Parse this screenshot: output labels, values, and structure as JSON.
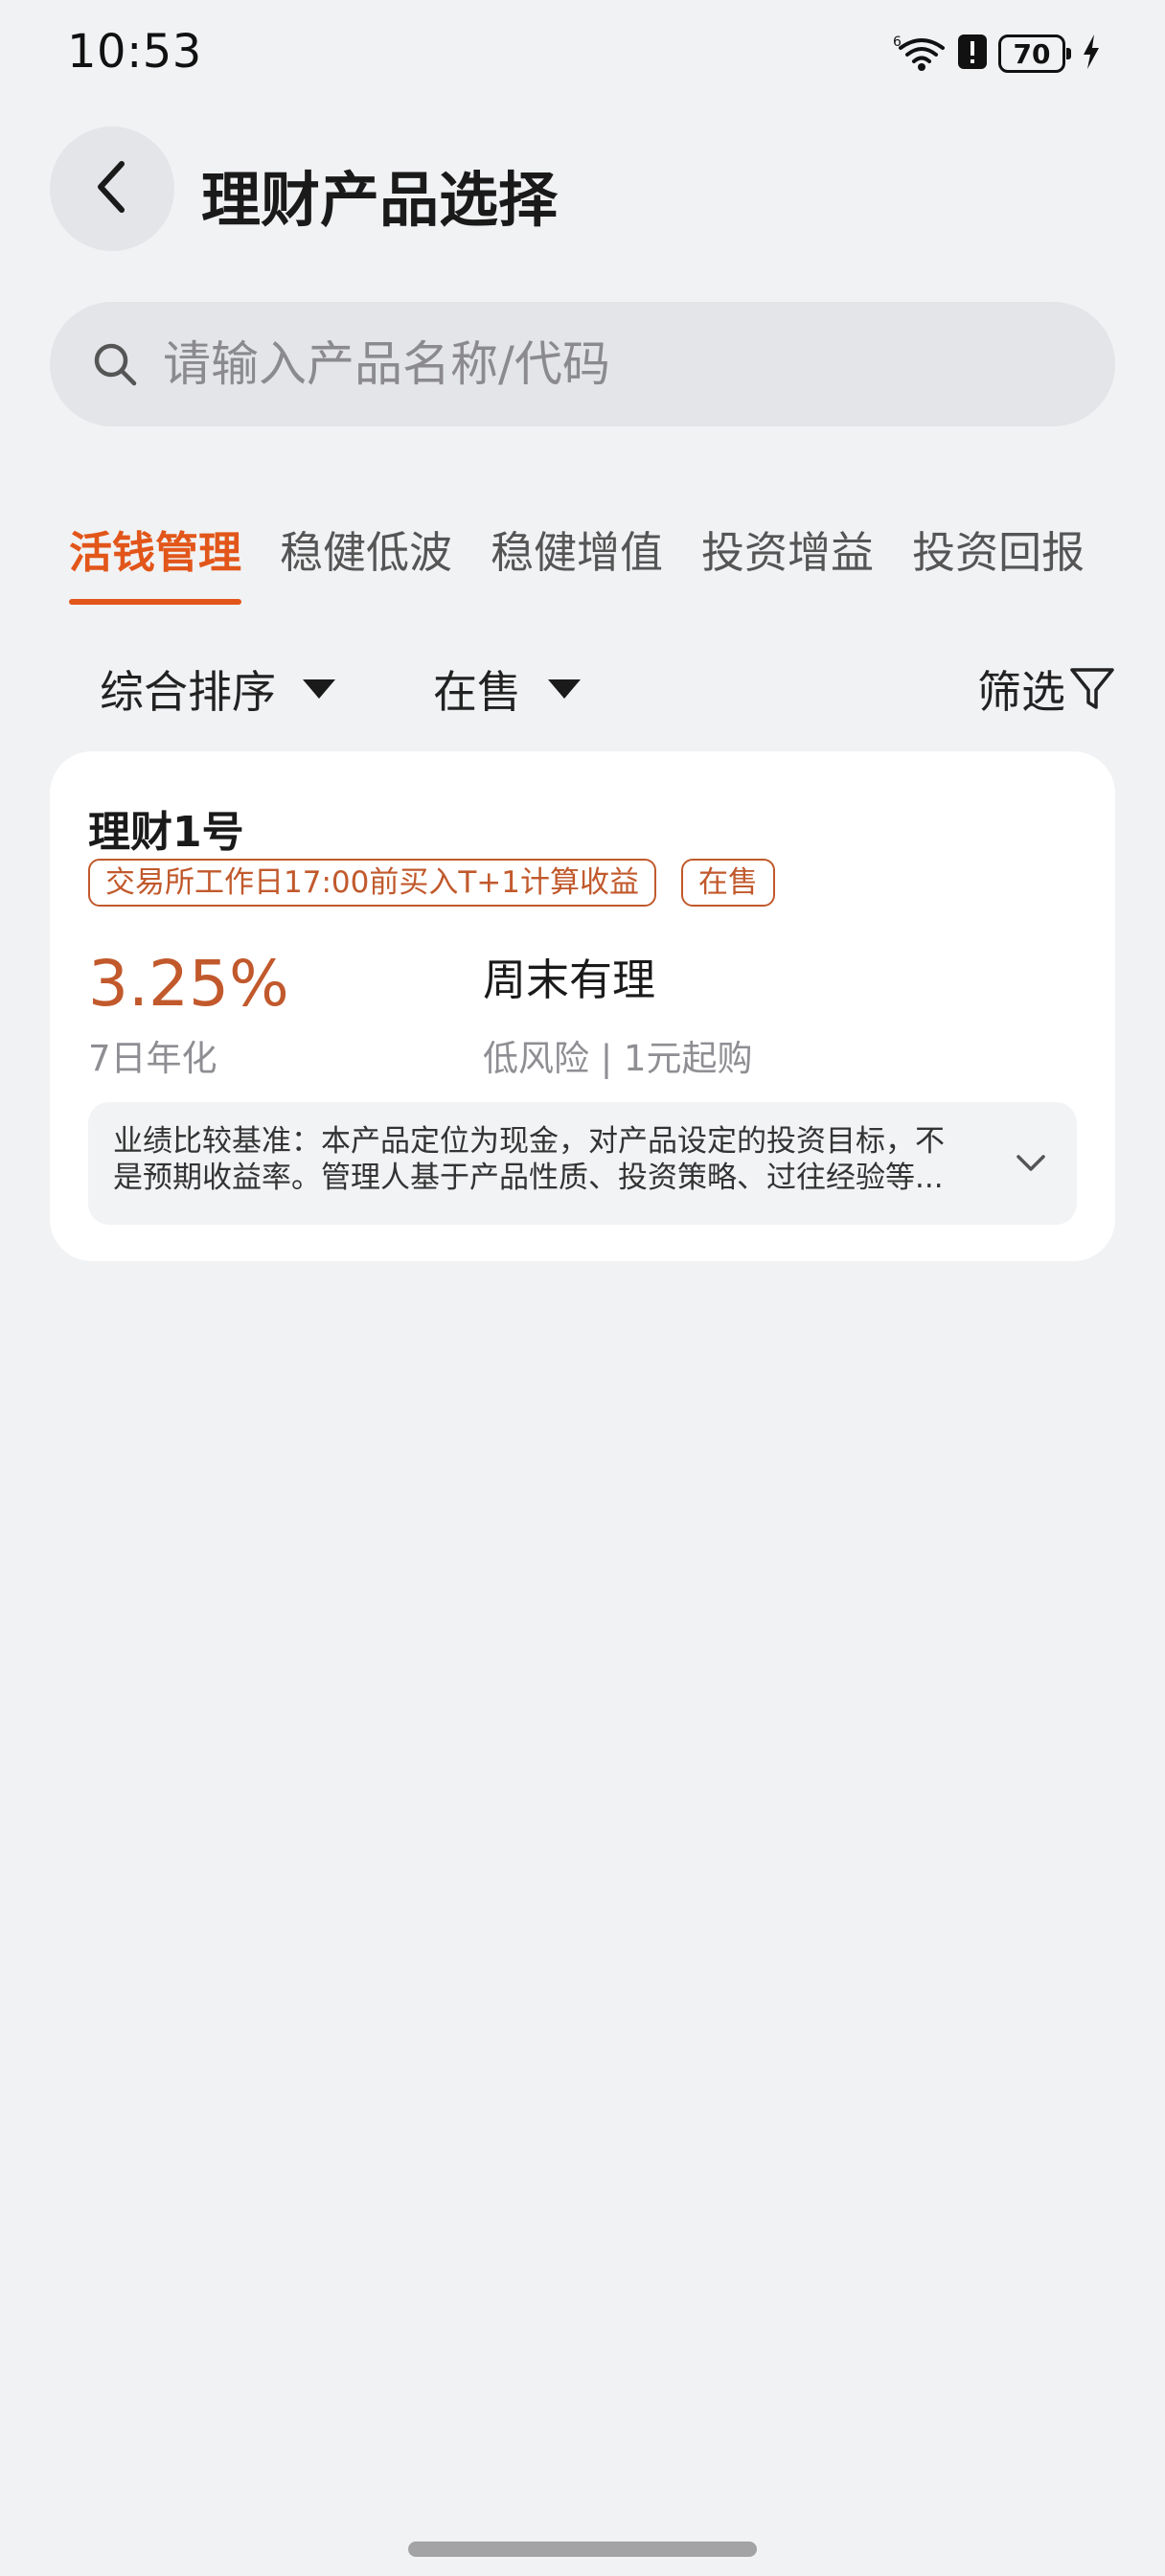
{
  "status_bar": {
    "time": "10:53",
    "battery": "70",
    "icons": [
      "wifi-icon",
      "alert-icon",
      "battery-icon",
      "charging-icon"
    ]
  },
  "header": {
    "title": "理财产品选择",
    "back_icon": "chevron-left-icon"
  },
  "search": {
    "placeholder": "请输入产品名称/代码",
    "value": ""
  },
  "tabs": [
    {
      "label": "活钱管理",
      "active": true
    },
    {
      "label": "稳健低波",
      "active": false
    },
    {
      "label": "稳健增值",
      "active": false
    },
    {
      "label": "投资增益",
      "active": false
    },
    {
      "label": "投资回报",
      "active": false
    }
  ],
  "filters": {
    "sort_label": "综合排序",
    "status_label": "在售",
    "filter_label": "筛选"
  },
  "products": [
    {
      "name": "理财1号",
      "tags": [
        "交易所工作日17:00前买入T+1计算收益",
        "在售"
      ],
      "rate": "3.25%",
      "rate_label": "7日年化",
      "subtitle": "周末有理",
      "meta": "低风险 | 1元起购",
      "benchmark": "业绩比较基准：本产品定位为现金，对产品设定的投资目标，不是预期收益率。管理人基于产品性质、投资策略、过往经验等..."
    }
  ],
  "colors": {
    "accent": "#e2561a",
    "tag": "#c1592c",
    "background": "#f1f2f4",
    "card": "#ffffff"
  }
}
